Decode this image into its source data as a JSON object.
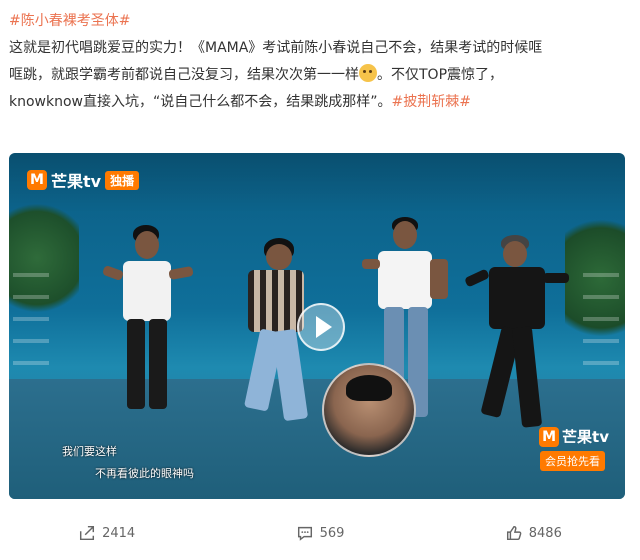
{
  "post": {
    "topic_tag": "#陈小春裸考圣体#",
    "line1": "这就是初代唱跳爱豆的实力！《MAMA》考试前陈小春说自己不会，结果考试的时候哐",
    "line2": "哐跳，就跟学霸考前都说自己没复习，结果次次第一一样",
    "line2_after_emoji": "。不仅TOP震惊了，",
    "line3": "knowknow直接入坑，“说自己什么都不会，结果跳成那样”。",
    "line3_tag": "#披荆斩棘#"
  },
  "video": {
    "logo_text": "芒果tv",
    "logo_badge": "独播",
    "caption_1": "我们要这样",
    "caption_2": "不再看彼此的眼神吗",
    "bottom_logo": "芒果tv",
    "member_badge": "会员抢先看"
  },
  "actions": {
    "share_count": "2414",
    "comment_count": "569",
    "like_count": "8486"
  },
  "colors": {
    "topic": "#eb7350",
    "mango_orange": "#ff7a00"
  }
}
